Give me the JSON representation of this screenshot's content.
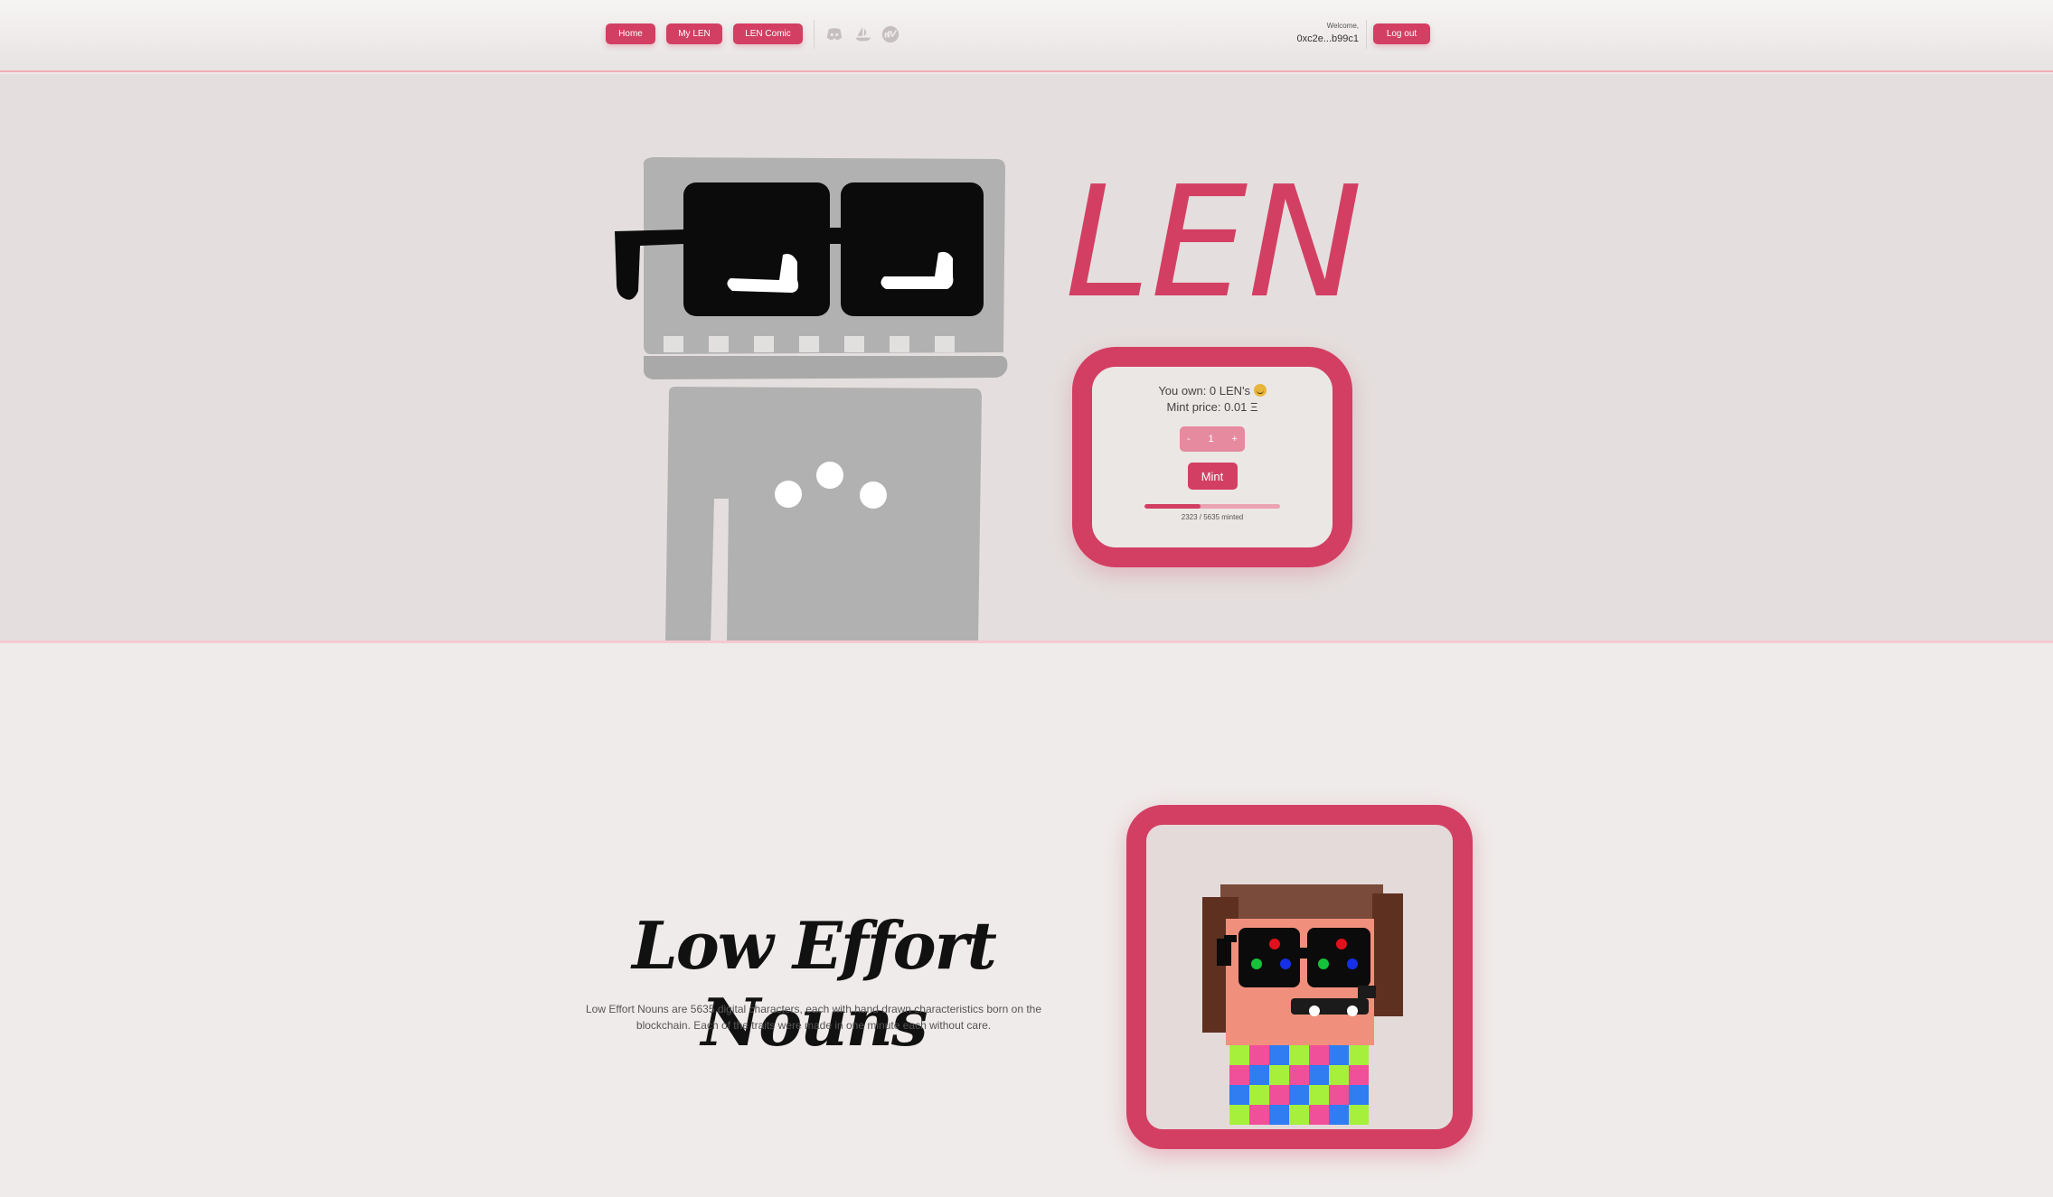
{
  "header": {
    "nav": [
      {
        "label": "Home"
      },
      {
        "label": "My LEN"
      },
      {
        "label": "LEN Comic"
      }
    ],
    "social_icons": [
      "discord-icon",
      "opensea-icon",
      "etherscan-icon"
    ],
    "welcome_label": "Welcome,",
    "wallet_address": "0xc2e...b99c1",
    "logout_label": "Log out"
  },
  "hero": {
    "logo_text": "LEN",
    "mint": {
      "own_text": "You own: 0 LEN's",
      "price_text": "Mint price: 0.01 Ξ",
      "quantity": "1",
      "decrement": "-",
      "increment": "+",
      "mint_label": "Mint",
      "minted_count": 2323,
      "total_supply": 5635,
      "minted_text": "2323 / 5635 minted"
    }
  },
  "about": {
    "title": "Low Effort Nouns",
    "description": "Low Effort Nouns are 5635 digital characters, each with hand drawn characteristics born on the blockchain. Each of the traits were made in one minute each without care."
  },
  "colors": {
    "accent": "#d33f63",
    "accent_light": "#e58a9f",
    "hero_bg": "#e4dfde",
    "page_bg": "#efebea"
  }
}
